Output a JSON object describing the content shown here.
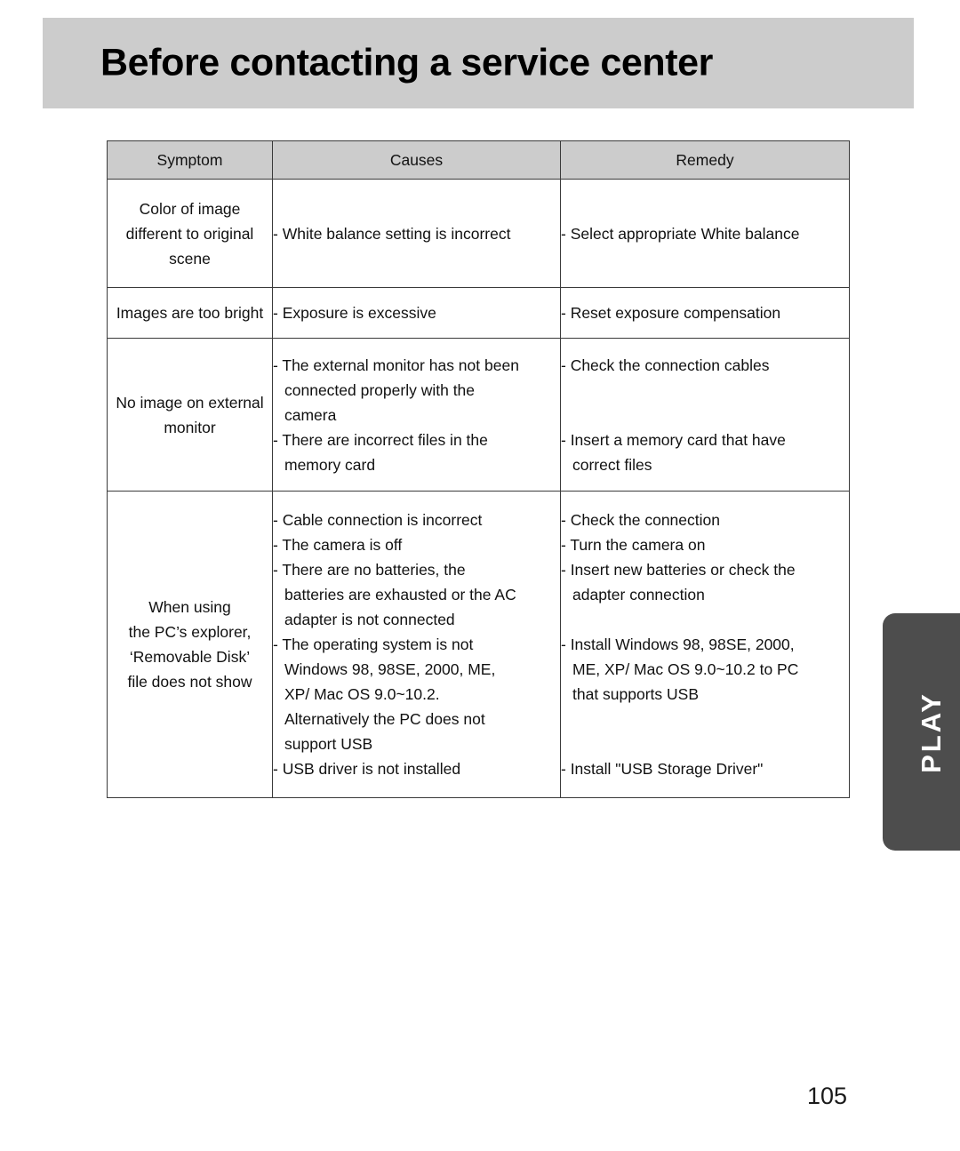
{
  "header": {
    "title": "Before contacting a service center"
  },
  "side_tab": {
    "label": "PLAY",
    "color": "#4d4d4d",
    "text_color": "#ffffff"
  },
  "page": {
    "number": "105"
  },
  "colors": {
    "header_band": "#cccccc",
    "table_header_fill": "#cccccc",
    "border": "#3a3a3a",
    "background": "#ffffff"
  },
  "table": {
    "columns": [
      "Symptom",
      "Causes",
      "Remedy"
    ],
    "rows": [
      {
        "symptom": [
          "Color of image",
          "different to original",
          "scene"
        ],
        "causes": [
          {
            "type": "bullet",
            "text": "- White balance setting is incorrect"
          }
        ],
        "remedy": [
          {
            "type": "bullet",
            "text": "- Select appropriate White balance"
          }
        ]
      },
      {
        "symptom": [
          "Images are too bright"
        ],
        "causes": [
          {
            "type": "bullet",
            "text": "- Exposure is excessive"
          }
        ],
        "remedy": [
          {
            "type": "bullet",
            "text": "- Reset exposure compensation"
          }
        ]
      },
      {
        "symptom": [
          "No image on external",
          "monitor"
        ],
        "causes": [
          {
            "type": "bullet",
            "text": "- The external monitor has not been"
          },
          {
            "type": "cont",
            "text": "connected properly with the"
          },
          {
            "type": "cont",
            "text": "camera"
          },
          {
            "type": "bullet",
            "text": "- There are incorrect files in the"
          },
          {
            "type": "cont",
            "text": "memory card"
          }
        ],
        "remedy": [
          {
            "type": "bullet",
            "text": "- Check the connection cables"
          },
          {
            "type": "blank",
            "text": ""
          },
          {
            "type": "blank",
            "text": ""
          },
          {
            "type": "bullet",
            "text": "- Insert a memory card that have"
          },
          {
            "type": "cont",
            "text": "correct files"
          }
        ]
      },
      {
        "symptom": [
          "When using",
          "the PC’s explorer,",
          "‘Removable Disk’",
          "file does not show"
        ],
        "causes": [
          {
            "type": "bullet",
            "text": "- Cable connection is incorrect"
          },
          {
            "type": "bullet",
            "text": "- The camera is off"
          },
          {
            "type": "bullet",
            "text": "- There are no batteries, the"
          },
          {
            "type": "cont",
            "text": "batteries are exhausted or the AC"
          },
          {
            "type": "cont",
            "text": "adapter is not connected"
          },
          {
            "type": "bullet",
            "text": "- The operating system is not"
          },
          {
            "type": "cont",
            "text": "Windows 98, 98SE, 2000, ME,"
          },
          {
            "type": "cont",
            "text": "XP/ Mac OS 9.0~10.2."
          },
          {
            "type": "cont",
            "text": "Alternatively the PC does not"
          },
          {
            "type": "cont",
            "text": "support USB"
          },
          {
            "type": "bullet",
            "text": "- USB driver is not installed"
          }
        ],
        "remedy": [
          {
            "type": "bullet",
            "text": "- Check the connection"
          },
          {
            "type": "bullet",
            "text": "- Turn the camera on"
          },
          {
            "type": "bullet",
            "text": "- Insert new batteries or check the"
          },
          {
            "type": "cont",
            "text": "adapter connection"
          },
          {
            "type": "blank",
            "text": ""
          },
          {
            "type": "bullet",
            "text": "- Install Windows 98, 98SE, 2000,"
          },
          {
            "type": "cont",
            "text": "ME, XP/ Mac OS 9.0~10.2 to PC"
          },
          {
            "type": "cont",
            "text": "that supports USB"
          },
          {
            "type": "blank",
            "text": ""
          },
          {
            "type": "blank",
            "text": ""
          },
          {
            "type": "bullet",
            "text": "- Install \"USB Storage Driver\""
          }
        ]
      }
    ]
  }
}
